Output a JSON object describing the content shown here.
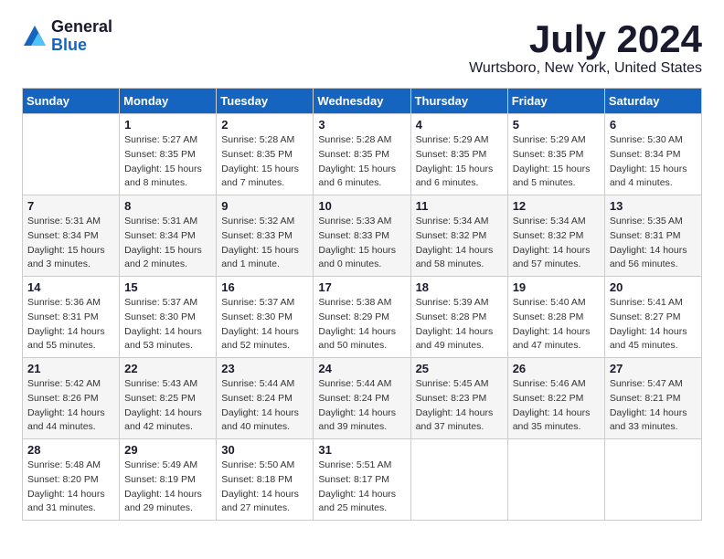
{
  "logo": {
    "general": "General",
    "blue": "Blue"
  },
  "header": {
    "month": "July 2024",
    "location": "Wurtsboro, New York, United States"
  },
  "weekdays": [
    "Sunday",
    "Monday",
    "Tuesday",
    "Wednesday",
    "Thursday",
    "Friday",
    "Saturday"
  ],
  "weeks": [
    [
      {
        "day": "",
        "info": ""
      },
      {
        "day": "1",
        "info": "Sunrise: 5:27 AM\nSunset: 8:35 PM\nDaylight: 15 hours\nand 8 minutes."
      },
      {
        "day": "2",
        "info": "Sunrise: 5:28 AM\nSunset: 8:35 PM\nDaylight: 15 hours\nand 7 minutes."
      },
      {
        "day": "3",
        "info": "Sunrise: 5:28 AM\nSunset: 8:35 PM\nDaylight: 15 hours\nand 6 minutes."
      },
      {
        "day": "4",
        "info": "Sunrise: 5:29 AM\nSunset: 8:35 PM\nDaylight: 15 hours\nand 6 minutes."
      },
      {
        "day": "5",
        "info": "Sunrise: 5:29 AM\nSunset: 8:35 PM\nDaylight: 15 hours\nand 5 minutes."
      },
      {
        "day": "6",
        "info": "Sunrise: 5:30 AM\nSunset: 8:34 PM\nDaylight: 15 hours\nand 4 minutes."
      }
    ],
    [
      {
        "day": "7",
        "info": "Sunrise: 5:31 AM\nSunset: 8:34 PM\nDaylight: 15 hours\nand 3 minutes."
      },
      {
        "day": "8",
        "info": "Sunrise: 5:31 AM\nSunset: 8:34 PM\nDaylight: 15 hours\nand 2 minutes."
      },
      {
        "day": "9",
        "info": "Sunrise: 5:32 AM\nSunset: 8:33 PM\nDaylight: 15 hours\nand 1 minute."
      },
      {
        "day": "10",
        "info": "Sunrise: 5:33 AM\nSunset: 8:33 PM\nDaylight: 15 hours\nand 0 minutes."
      },
      {
        "day": "11",
        "info": "Sunrise: 5:34 AM\nSunset: 8:32 PM\nDaylight: 14 hours\nand 58 minutes."
      },
      {
        "day": "12",
        "info": "Sunrise: 5:34 AM\nSunset: 8:32 PM\nDaylight: 14 hours\nand 57 minutes."
      },
      {
        "day": "13",
        "info": "Sunrise: 5:35 AM\nSunset: 8:31 PM\nDaylight: 14 hours\nand 56 minutes."
      }
    ],
    [
      {
        "day": "14",
        "info": "Sunrise: 5:36 AM\nSunset: 8:31 PM\nDaylight: 14 hours\nand 55 minutes."
      },
      {
        "day": "15",
        "info": "Sunrise: 5:37 AM\nSunset: 8:30 PM\nDaylight: 14 hours\nand 53 minutes."
      },
      {
        "day": "16",
        "info": "Sunrise: 5:37 AM\nSunset: 8:30 PM\nDaylight: 14 hours\nand 52 minutes."
      },
      {
        "day": "17",
        "info": "Sunrise: 5:38 AM\nSunset: 8:29 PM\nDaylight: 14 hours\nand 50 minutes."
      },
      {
        "day": "18",
        "info": "Sunrise: 5:39 AM\nSunset: 8:28 PM\nDaylight: 14 hours\nand 49 minutes."
      },
      {
        "day": "19",
        "info": "Sunrise: 5:40 AM\nSunset: 8:28 PM\nDaylight: 14 hours\nand 47 minutes."
      },
      {
        "day": "20",
        "info": "Sunrise: 5:41 AM\nSunset: 8:27 PM\nDaylight: 14 hours\nand 45 minutes."
      }
    ],
    [
      {
        "day": "21",
        "info": "Sunrise: 5:42 AM\nSunset: 8:26 PM\nDaylight: 14 hours\nand 44 minutes."
      },
      {
        "day": "22",
        "info": "Sunrise: 5:43 AM\nSunset: 8:25 PM\nDaylight: 14 hours\nand 42 minutes."
      },
      {
        "day": "23",
        "info": "Sunrise: 5:44 AM\nSunset: 8:24 PM\nDaylight: 14 hours\nand 40 minutes."
      },
      {
        "day": "24",
        "info": "Sunrise: 5:44 AM\nSunset: 8:24 PM\nDaylight: 14 hours\nand 39 minutes."
      },
      {
        "day": "25",
        "info": "Sunrise: 5:45 AM\nSunset: 8:23 PM\nDaylight: 14 hours\nand 37 minutes."
      },
      {
        "day": "26",
        "info": "Sunrise: 5:46 AM\nSunset: 8:22 PM\nDaylight: 14 hours\nand 35 minutes."
      },
      {
        "day": "27",
        "info": "Sunrise: 5:47 AM\nSunset: 8:21 PM\nDaylight: 14 hours\nand 33 minutes."
      }
    ],
    [
      {
        "day": "28",
        "info": "Sunrise: 5:48 AM\nSunset: 8:20 PM\nDaylight: 14 hours\nand 31 minutes."
      },
      {
        "day": "29",
        "info": "Sunrise: 5:49 AM\nSunset: 8:19 PM\nDaylight: 14 hours\nand 29 minutes."
      },
      {
        "day": "30",
        "info": "Sunrise: 5:50 AM\nSunset: 8:18 PM\nDaylight: 14 hours\nand 27 minutes."
      },
      {
        "day": "31",
        "info": "Sunrise: 5:51 AM\nSunset: 8:17 PM\nDaylight: 14 hours\nand 25 minutes."
      },
      {
        "day": "",
        "info": ""
      },
      {
        "day": "",
        "info": ""
      },
      {
        "day": "",
        "info": ""
      }
    ]
  ]
}
